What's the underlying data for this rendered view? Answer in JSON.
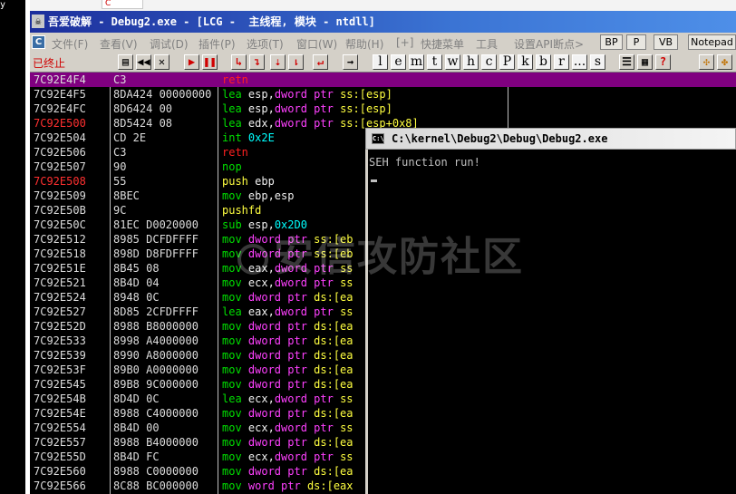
{
  "background": {
    "tab_label": "C",
    "left_glyph": "y"
  },
  "window": {
    "title": "吾爱破解 - Debug2.exe - [LCG -  主线程, 模块 - ntdll]",
    "icon_letter": "C"
  },
  "menu": {
    "items": [
      "文件(F)",
      "查看(V)",
      "调试(D)",
      "插件(P)",
      "选项(T)",
      "窗口(W)",
      "帮助(H)",
      "[+]",
      "快捷菜单",
      "工具",
      "设置API断点>"
    ],
    "right_buttons": [
      "BP",
      "P",
      "VB",
      "Notepad"
    ]
  },
  "toolbar": {
    "status": "已终止",
    "letters": [
      "l",
      "e",
      "m",
      "t",
      "w",
      "h",
      "c",
      "P",
      "k",
      "b",
      "r",
      "...",
      "s"
    ]
  },
  "cpu": {
    "rows": [
      {
        "addr": "7C92E4F4",
        "hex": "C3",
        "segs": [
          [
            "retn",
            "red"
          ]
        ],
        "selected": true
      },
      {
        "addr": "7C92E4F5",
        "hex": "8DA424 00000000",
        "segs": [
          [
            "lea ",
            "green"
          ],
          [
            "esp,",
            "white"
          ],
          [
            "dword ptr ",
            "magenta"
          ],
          [
            "ss:[esp]",
            "yellow"
          ]
        ]
      },
      {
        "addr": "7C92E4FC",
        "hex": "8D6424 00",
        "segs": [
          [
            "lea ",
            "green"
          ],
          [
            "esp,",
            "white"
          ],
          [
            "dword ptr ",
            "magenta"
          ],
          [
            "ss:[esp]",
            "yellow"
          ]
        ]
      },
      {
        "addr": "7C92E500",
        "hex": "8D5424 08",
        "segs": [
          [
            "lea ",
            "green"
          ],
          [
            "edx,",
            "white"
          ],
          [
            "dword ptr ",
            "magenta"
          ],
          [
            "ss:[esp+0x8]",
            "yellow"
          ]
        ],
        "red_addr": true
      },
      {
        "addr": "7C92E504",
        "hex": "CD 2E",
        "segs": [
          [
            "int ",
            "green"
          ],
          [
            "0x2E",
            "cyan"
          ]
        ]
      },
      {
        "addr": "7C92E506",
        "hex": "C3",
        "segs": [
          [
            "retn",
            "red"
          ]
        ]
      },
      {
        "addr": "7C92E507",
        "hex": "90",
        "segs": [
          [
            "nop",
            "green"
          ]
        ]
      },
      {
        "addr": "7C92E508",
        "hex": "55",
        "segs": [
          [
            "push ",
            "yellow"
          ],
          [
            "ebp",
            "white"
          ]
        ],
        "red_addr": true
      },
      {
        "addr": "7C92E509",
        "hex": "8BEC",
        "segs": [
          [
            "mov ",
            "green"
          ],
          [
            "ebp,esp",
            "white"
          ]
        ]
      },
      {
        "addr": "7C92E50B",
        "hex": "9C",
        "segs": [
          [
            "pushfd",
            "yellow"
          ]
        ]
      },
      {
        "addr": "7C92E50C",
        "hex": "81EC D0020000",
        "segs": [
          [
            "sub ",
            "green"
          ],
          [
            "esp,",
            "white"
          ],
          [
            "0x2D0",
            "cyan"
          ]
        ]
      },
      {
        "addr": "7C92E512",
        "hex": "8985 DCFDFFFF",
        "segs": [
          [
            "mov ",
            "green"
          ],
          [
            "dword ptr ",
            "magenta"
          ],
          [
            "ss:[eb",
            "yellow"
          ]
        ]
      },
      {
        "addr": "7C92E518",
        "hex": "898D D8FDFFFF",
        "segs": [
          [
            "mov ",
            "green"
          ],
          [
            "dword ptr ",
            "magenta"
          ],
          [
            "ss:[eb",
            "yellow"
          ]
        ]
      },
      {
        "addr": "7C92E51E",
        "hex": "8B45 08",
        "segs": [
          [
            "mov ",
            "green"
          ],
          [
            "eax,",
            "white"
          ],
          [
            "dword ptr ",
            "magenta"
          ],
          [
            "ss",
            "yellow"
          ]
        ]
      },
      {
        "addr": "7C92E521",
        "hex": "8B4D 04",
        "segs": [
          [
            "mov ",
            "green"
          ],
          [
            "ecx,",
            "white"
          ],
          [
            "dword ptr ",
            "magenta"
          ],
          [
            "ss",
            "yellow"
          ]
        ]
      },
      {
        "addr": "7C92E524",
        "hex": "8948 0C",
        "segs": [
          [
            "mov ",
            "green"
          ],
          [
            "dword ptr ",
            "magenta"
          ],
          [
            "ds:[ea",
            "yellow"
          ]
        ]
      },
      {
        "addr": "7C92E527",
        "hex": "8D85 2CFDFFFF",
        "segs": [
          [
            "lea ",
            "green"
          ],
          [
            "eax,",
            "white"
          ],
          [
            "dword ptr ",
            "magenta"
          ],
          [
            "ss",
            "yellow"
          ]
        ]
      },
      {
        "addr": "7C92E52D",
        "hex": "8988 B8000000",
        "segs": [
          [
            "mov ",
            "green"
          ],
          [
            "dword ptr ",
            "magenta"
          ],
          [
            "ds:[ea",
            "yellow"
          ]
        ]
      },
      {
        "addr": "7C92E533",
        "hex": "8998 A4000000",
        "segs": [
          [
            "mov ",
            "green"
          ],
          [
            "dword ptr ",
            "magenta"
          ],
          [
            "ds:[ea",
            "yellow"
          ]
        ]
      },
      {
        "addr": "7C92E539",
        "hex": "8990 A8000000",
        "segs": [
          [
            "mov ",
            "green"
          ],
          [
            "dword ptr ",
            "magenta"
          ],
          [
            "ds:[ea",
            "yellow"
          ]
        ]
      },
      {
        "addr": "7C92E53F",
        "hex": "89B0 A0000000",
        "segs": [
          [
            "mov ",
            "green"
          ],
          [
            "dword ptr ",
            "magenta"
          ],
          [
            "ds:[ea",
            "yellow"
          ]
        ]
      },
      {
        "addr": "7C92E545",
        "hex": "89B8 9C000000",
        "segs": [
          [
            "mov ",
            "green"
          ],
          [
            "dword ptr ",
            "magenta"
          ],
          [
            "ds:[ea",
            "yellow"
          ]
        ]
      },
      {
        "addr": "7C92E54B",
        "hex": "8D4D 0C",
        "segs": [
          [
            "lea ",
            "green"
          ],
          [
            "ecx,",
            "white"
          ],
          [
            "dword ptr ",
            "magenta"
          ],
          [
            "ss",
            "yellow"
          ]
        ]
      },
      {
        "addr": "7C92E54E",
        "hex": "8988 C4000000",
        "segs": [
          [
            "mov ",
            "green"
          ],
          [
            "dword ptr ",
            "magenta"
          ],
          [
            "ds:[ea",
            "yellow"
          ]
        ]
      },
      {
        "addr": "7C92E554",
        "hex": "8B4D 00",
        "segs": [
          [
            "mov ",
            "green"
          ],
          [
            "ecx,",
            "white"
          ],
          [
            "dword ptr ",
            "magenta"
          ],
          [
            "ss",
            "yellow"
          ]
        ]
      },
      {
        "addr": "7C92E557",
        "hex": "8988 B4000000",
        "segs": [
          [
            "mov ",
            "green"
          ],
          [
            "dword ptr ",
            "magenta"
          ],
          [
            "ds:[ea",
            "yellow"
          ]
        ]
      },
      {
        "addr": "7C92E55D",
        "hex": "8B4D FC",
        "segs": [
          [
            "mov ",
            "green"
          ],
          [
            "ecx,",
            "white"
          ],
          [
            "dword ptr ",
            "magenta"
          ],
          [
            "ss",
            "yellow"
          ]
        ]
      },
      {
        "addr": "7C92E560",
        "hex": "8988 C0000000",
        "segs": [
          [
            "mov ",
            "green"
          ],
          [
            "dword ptr ",
            "magenta"
          ],
          [
            "ds:[ea",
            "yellow"
          ]
        ]
      },
      {
        "addr": "7C92E566",
        "hex": "8C88 BC000000",
        "segs": [
          [
            "mov ",
            "green"
          ],
          [
            "word ptr ",
            "magenta"
          ],
          [
            "ds:[eax",
            "yellow"
          ]
        ]
      }
    ]
  },
  "console": {
    "title": "C:\\kernel\\Debug2\\Debug\\Debug2.exe",
    "icon_text": "C:\\",
    "output": "SEH function run!"
  },
  "watermark": "安信攻防社区",
  "colors": {
    "selected_row": "#800080",
    "titlebar": "#1c2e9c",
    "address_red": "#ff3030"
  }
}
